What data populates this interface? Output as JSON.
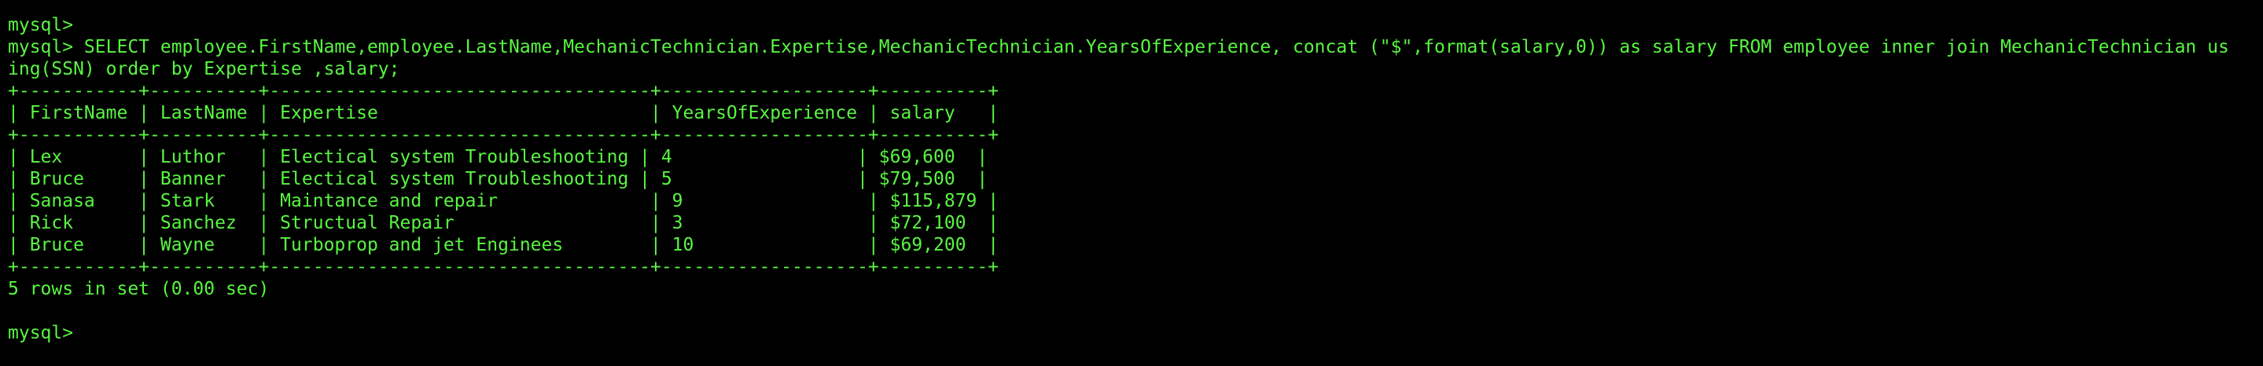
{
  "terminal": {
    "color": "#59f542",
    "background": "#000000",
    "lines": [
      "mysql>",
      "mysql> SELECT employee.FirstName,employee.LastName,MechanicTechnician.Expertise,MechanicTechnician.YearsOfExperience, concat (\"$\",format(salary,0)) as salary FROM employee inner join MechanicTechnician us",
      "ing(SSN) order by Expertise ,salary;",
      "+-----------+----------+-----------------------------------+-------------------+----------+",
      "| FirstName | LastName | Expertise                         | YearsOfExperience | salary   |",
      "+-----------+----------+-----------------------------------+-------------------+----------+",
      "| Lex       | Luthor   | Electical system Troubleshooting | 4                 | $69,600  |",
      "| Bruce     | Banner   | Electical system Troubleshooting | 5                 | $79,500  |",
      "| Sanasa    | Stark    | Maintance and repair              | 9                 | $115,879 |",
      "| Rick      | Sanchez  | Structual Repair                  | 3                 | $72,100  |",
      "| Bruce     | Wayne    | Turboprop and jet Enginees        | 10                | $69,200  |",
      "+-----------+----------+-----------------------------------+-------------------+----------+",
      "5 rows in set (0.00 sec)",
      "",
      "mysql>"
    ]
  }
}
